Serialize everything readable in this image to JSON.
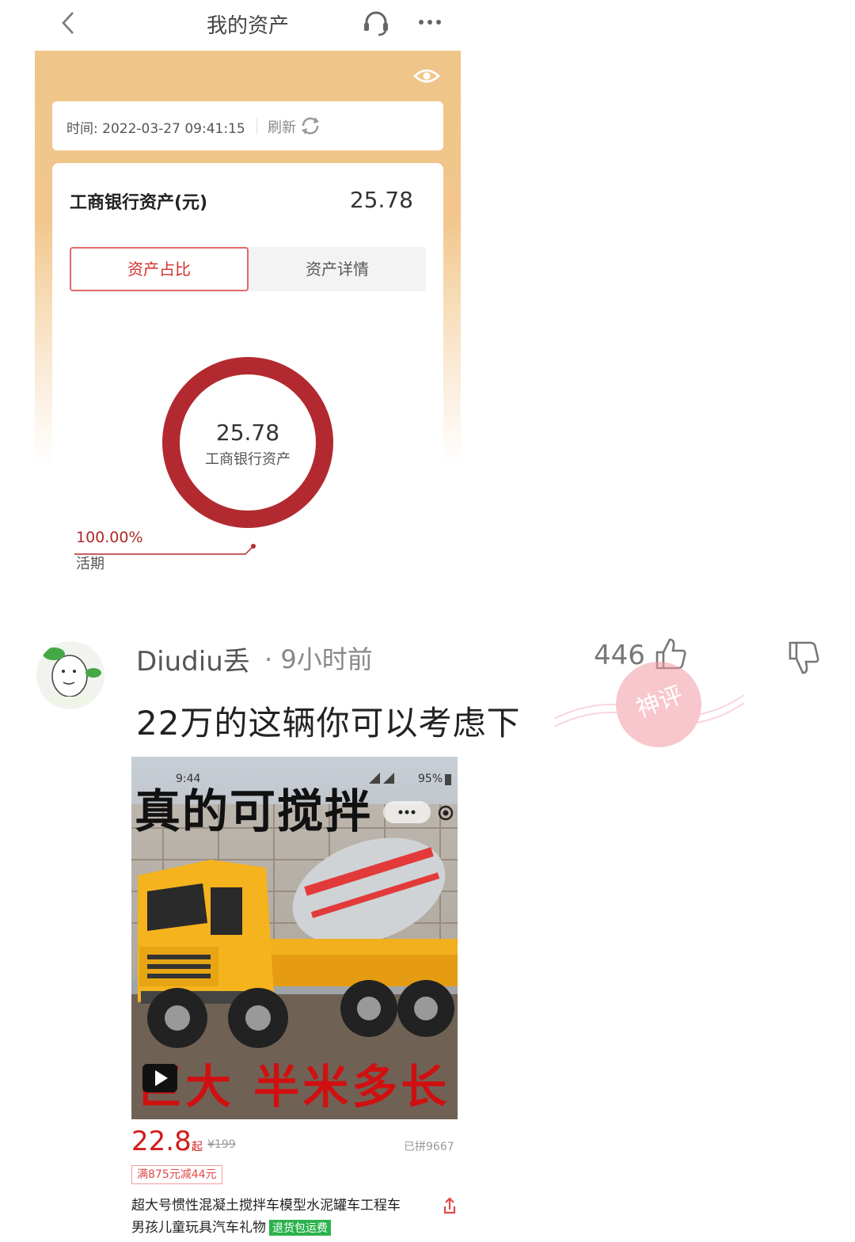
{
  "bank_page": {
    "title": "我的资产",
    "time_label": "时间: 2022-03-27 09:41:15",
    "refresh_label": "刷新",
    "asset_title": "工商银行资产(元)",
    "asset_total": "25.78",
    "tabs": [
      {
        "label": "资产占比",
        "active": true
      },
      {
        "label": "资产详情",
        "active": false
      }
    ],
    "donut": {
      "value": "25.78",
      "label": "工商银行资产"
    },
    "legend": {
      "percent": "100.00%",
      "category": "活期"
    },
    "colors": {
      "accent": "#b22a30",
      "header_gold": "#efc58a"
    }
  },
  "comment": {
    "user_name": "Diudiu丢",
    "time": "· 9小时前",
    "likes": "446",
    "text": "22万的这辆你可以考虑下",
    "stamp_text": "神评"
  },
  "product": {
    "overlay_top": "真的可搅拌",
    "overlay_bottom": "巨大 半米多长",
    "status_time": "9:44",
    "status_battery": "95%",
    "price": "22.8",
    "price_qi": "起",
    "price_old": "¥199",
    "sold": "已拼9667",
    "coupon": "满875元减44元",
    "title_line1": "超大号惯性混凝土搅拌车模型水泥罐车工程车",
    "title_line2": "男孩儿童玩具汽车礼物",
    "tag": "退货包运费"
  }
}
